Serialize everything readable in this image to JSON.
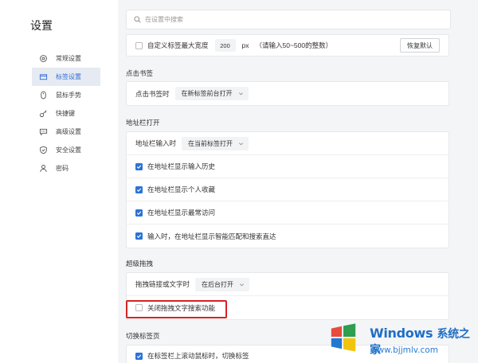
{
  "app": {
    "title": "设置"
  },
  "sidebar": {
    "items": [
      {
        "label": "常规设置",
        "icon": "gear-icon",
        "active": false
      },
      {
        "label": "标签设置",
        "icon": "tab-icon",
        "active": true
      },
      {
        "label": "鼠标手势",
        "icon": "mouse-icon",
        "active": false
      },
      {
        "label": "快捷键",
        "icon": "key-icon",
        "active": false
      },
      {
        "label": "高级设置",
        "icon": "chat-icon",
        "active": false
      },
      {
        "label": "安全设置",
        "icon": "shield-icon",
        "active": false
      },
      {
        "label": "密码",
        "icon": "user-icon",
        "active": false
      }
    ]
  },
  "search": {
    "placeholder": "在设置中搜索",
    "value": ""
  },
  "tab_width": {
    "label": "自定义标签最大宽度",
    "checked": false,
    "value": "200",
    "unit": "px",
    "hint": "（请输入50~500的整数）",
    "reset_label": "恢复默认"
  },
  "bookmark": {
    "section": "点击书签",
    "row_label": "点击书签时",
    "selected": "在新标签前台打开"
  },
  "address_bar": {
    "section": "地址栏打开",
    "row_label": "地址栏输入时",
    "selected": "在当前标签打开",
    "options": [
      {
        "label": "在地址栏显示输入历史",
        "checked": true
      },
      {
        "label": "在地址栏显示个人收藏",
        "checked": true
      },
      {
        "label": "在地址栏显示最常访问",
        "checked": true
      },
      {
        "label": "输入时，在地址栏显示智能匹配和搜索直达",
        "checked": true
      }
    ]
  },
  "super_drag": {
    "section": "超级拖拽",
    "row_label": "拖拽链接或文字时",
    "selected": "在后台打开",
    "option": {
      "label": "关闭拖拽文字搜索功能",
      "checked": false
    }
  },
  "switch_tab": {
    "section": "切换标签页",
    "option": {
      "label": "在标签栏上滚动鼠标时，切换标签",
      "checked": true
    }
  },
  "watermark": {
    "brand": "Windows",
    "brand_cn": "系统之家",
    "url": "www.bjjmlv.com"
  },
  "colors": {
    "accent": "#2b73d6",
    "highlight": "#d42424",
    "brand": "#1f6fc5"
  }
}
